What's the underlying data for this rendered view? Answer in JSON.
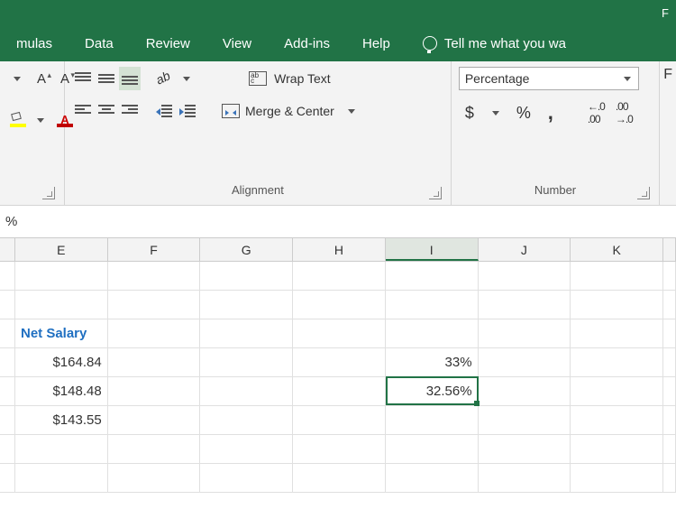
{
  "title_partial": "F",
  "menu": {
    "mulas": "mulas",
    "data": "Data",
    "review": "Review",
    "view": "View",
    "addins": "Add-ins",
    "help": "Help",
    "tellme": "Tell me what you wa"
  },
  "ribbon": {
    "font": {
      "grow": "A",
      "shrink": "A"
    },
    "alignment": {
      "label": "Alignment",
      "wrap": "Wrap Text",
      "merge": "Merge & Center"
    },
    "number": {
      "label": "Number",
      "format": "Percentage",
      "currency": "$",
      "percent": "%",
      "comma": ",",
      "inc_dec": "←.0\n.00",
      "dec_dec": ".00\n→.0"
    }
  },
  "formula_bar": "%",
  "columns": {
    "width_partial_left": 17,
    "widths": [
      103,
      103,
      103,
      103,
      103,
      103,
      103,
      14
    ],
    "labels": [
      "E",
      "F",
      "G",
      "H",
      "I",
      "J",
      "K",
      ""
    ]
  },
  "cells": {
    "row1": [
      "",
      "",
      "",
      "",
      "",
      "",
      "",
      ""
    ],
    "row2": [
      "",
      "",
      "",
      "",
      "",
      "",
      "",
      ""
    ],
    "row3": [
      "Net Salary",
      "",
      "",
      "",
      "",
      "",
      "",
      ""
    ],
    "row4": [
      "$164.84",
      "",
      "",
      "",
      "33%",
      "",
      "",
      ""
    ],
    "row5": [
      "$148.48",
      "",
      "",
      "",
      "32.56%",
      "",
      "",
      ""
    ],
    "row6": [
      "$143.55",
      "",
      "",
      "",
      "",
      "",
      "",
      ""
    ],
    "row7": [
      "",
      "",
      "",
      "",
      "",
      "",
      "",
      ""
    ],
    "row8": [
      "",
      "",
      "",
      "",
      "",
      "",
      "",
      ""
    ]
  },
  "active": {
    "col_index": 4,
    "row_index": 4
  }
}
